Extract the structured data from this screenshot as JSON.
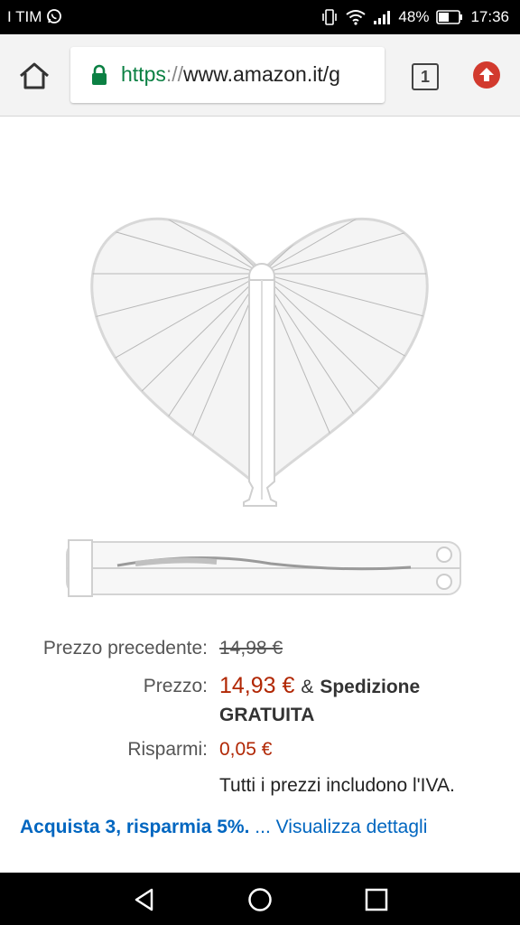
{
  "status_bar": {
    "carrier": "I TIM",
    "battery": "48%",
    "time": "17:36"
  },
  "browser": {
    "url_scheme": "https",
    "url_sep": "://",
    "url_host": "www.amazon.it/g",
    "tab_count": "1"
  },
  "product": {
    "image_icon": "heart-paper-fan-image"
  },
  "price": {
    "previous_label": "Prezzo precedente:",
    "previous_value": "14,98 €",
    "price_label": "Prezzo:",
    "price_value": "14,93 €",
    "shipping_amp": "&",
    "shipping_word1": "Spedizione",
    "shipping_word2": "GRATUITA",
    "savings_label": "Risparmi:",
    "savings_value": "0,05 €",
    "vat_note": "Tutti i prezzi includono l'IVA."
  },
  "deal": {
    "offer": "Acquista 3, risparmia 5%.",
    "ellipsis": "...",
    "details_link": "Visualizza dettagli"
  },
  "colors": {
    "price_red": "#b12704",
    "link_blue": "#0066c0",
    "lock_green": "#0b8043"
  }
}
